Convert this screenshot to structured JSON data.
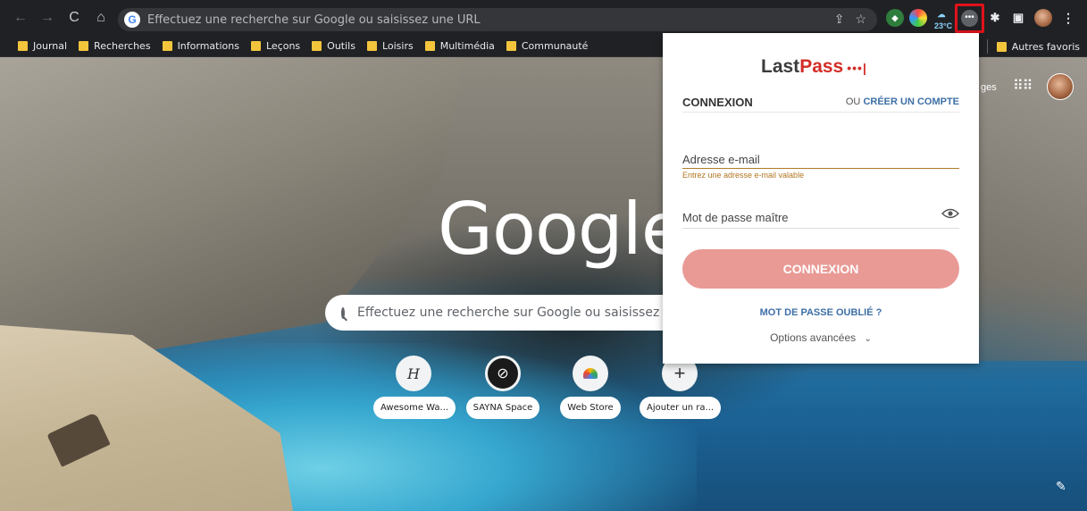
{
  "browser": {
    "omnibox_placeholder": "Effectuez une recherche sur Google ou saisissez une URL",
    "weather_temp": "23°C",
    "icons": [
      "back-icon",
      "forward-icon",
      "reload-icon",
      "home-icon",
      "share-icon",
      "star-icon",
      "extensions-icon",
      "side-panel-icon",
      "menu-icon"
    ]
  },
  "bookmarks": {
    "items": [
      "Journal",
      "Recherches",
      "Informations",
      "Leçons",
      "Outils",
      "Loisirs",
      "Multimédia",
      "Communauté"
    ],
    "other": "Autres favoris"
  },
  "google": {
    "logo": "Google",
    "search_placeholder": "Effectuez une recherche sur Google ou saisissez une",
    "header_link_fragment": "ges",
    "shortcuts": [
      {
        "label": "Awesome Wa...",
        "icon": "awesome-icon"
      },
      {
        "label": "SAYNA Space",
        "icon": "sayna-icon"
      },
      {
        "label": "Web Store",
        "icon": "webstore-icon"
      },
      {
        "label": "Ajouter un ra...",
        "icon": "plus-icon"
      }
    ]
  },
  "lastpass": {
    "logo_last": "Last",
    "logo_pass": "Pass",
    "logo_dots": "•••|",
    "tab_login": "CONNEXION",
    "tab_or": "OU",
    "tab_create": "CRÉER UN COMPTE",
    "email_label": "Adresse e-mail",
    "email_error": "Entrez une adresse e-mail valable",
    "password_label": "Mot de passe maître",
    "connect_button": "CONNEXION",
    "forgot": "MOT DE PASSE OUBLIÉ ?",
    "advanced": "Options avancées"
  },
  "colors": {
    "highlight": "#e0121a",
    "lastpass_red": "#d32d27",
    "button": "#e99a95",
    "link": "#3d6fa6",
    "error": "#b0771f"
  }
}
